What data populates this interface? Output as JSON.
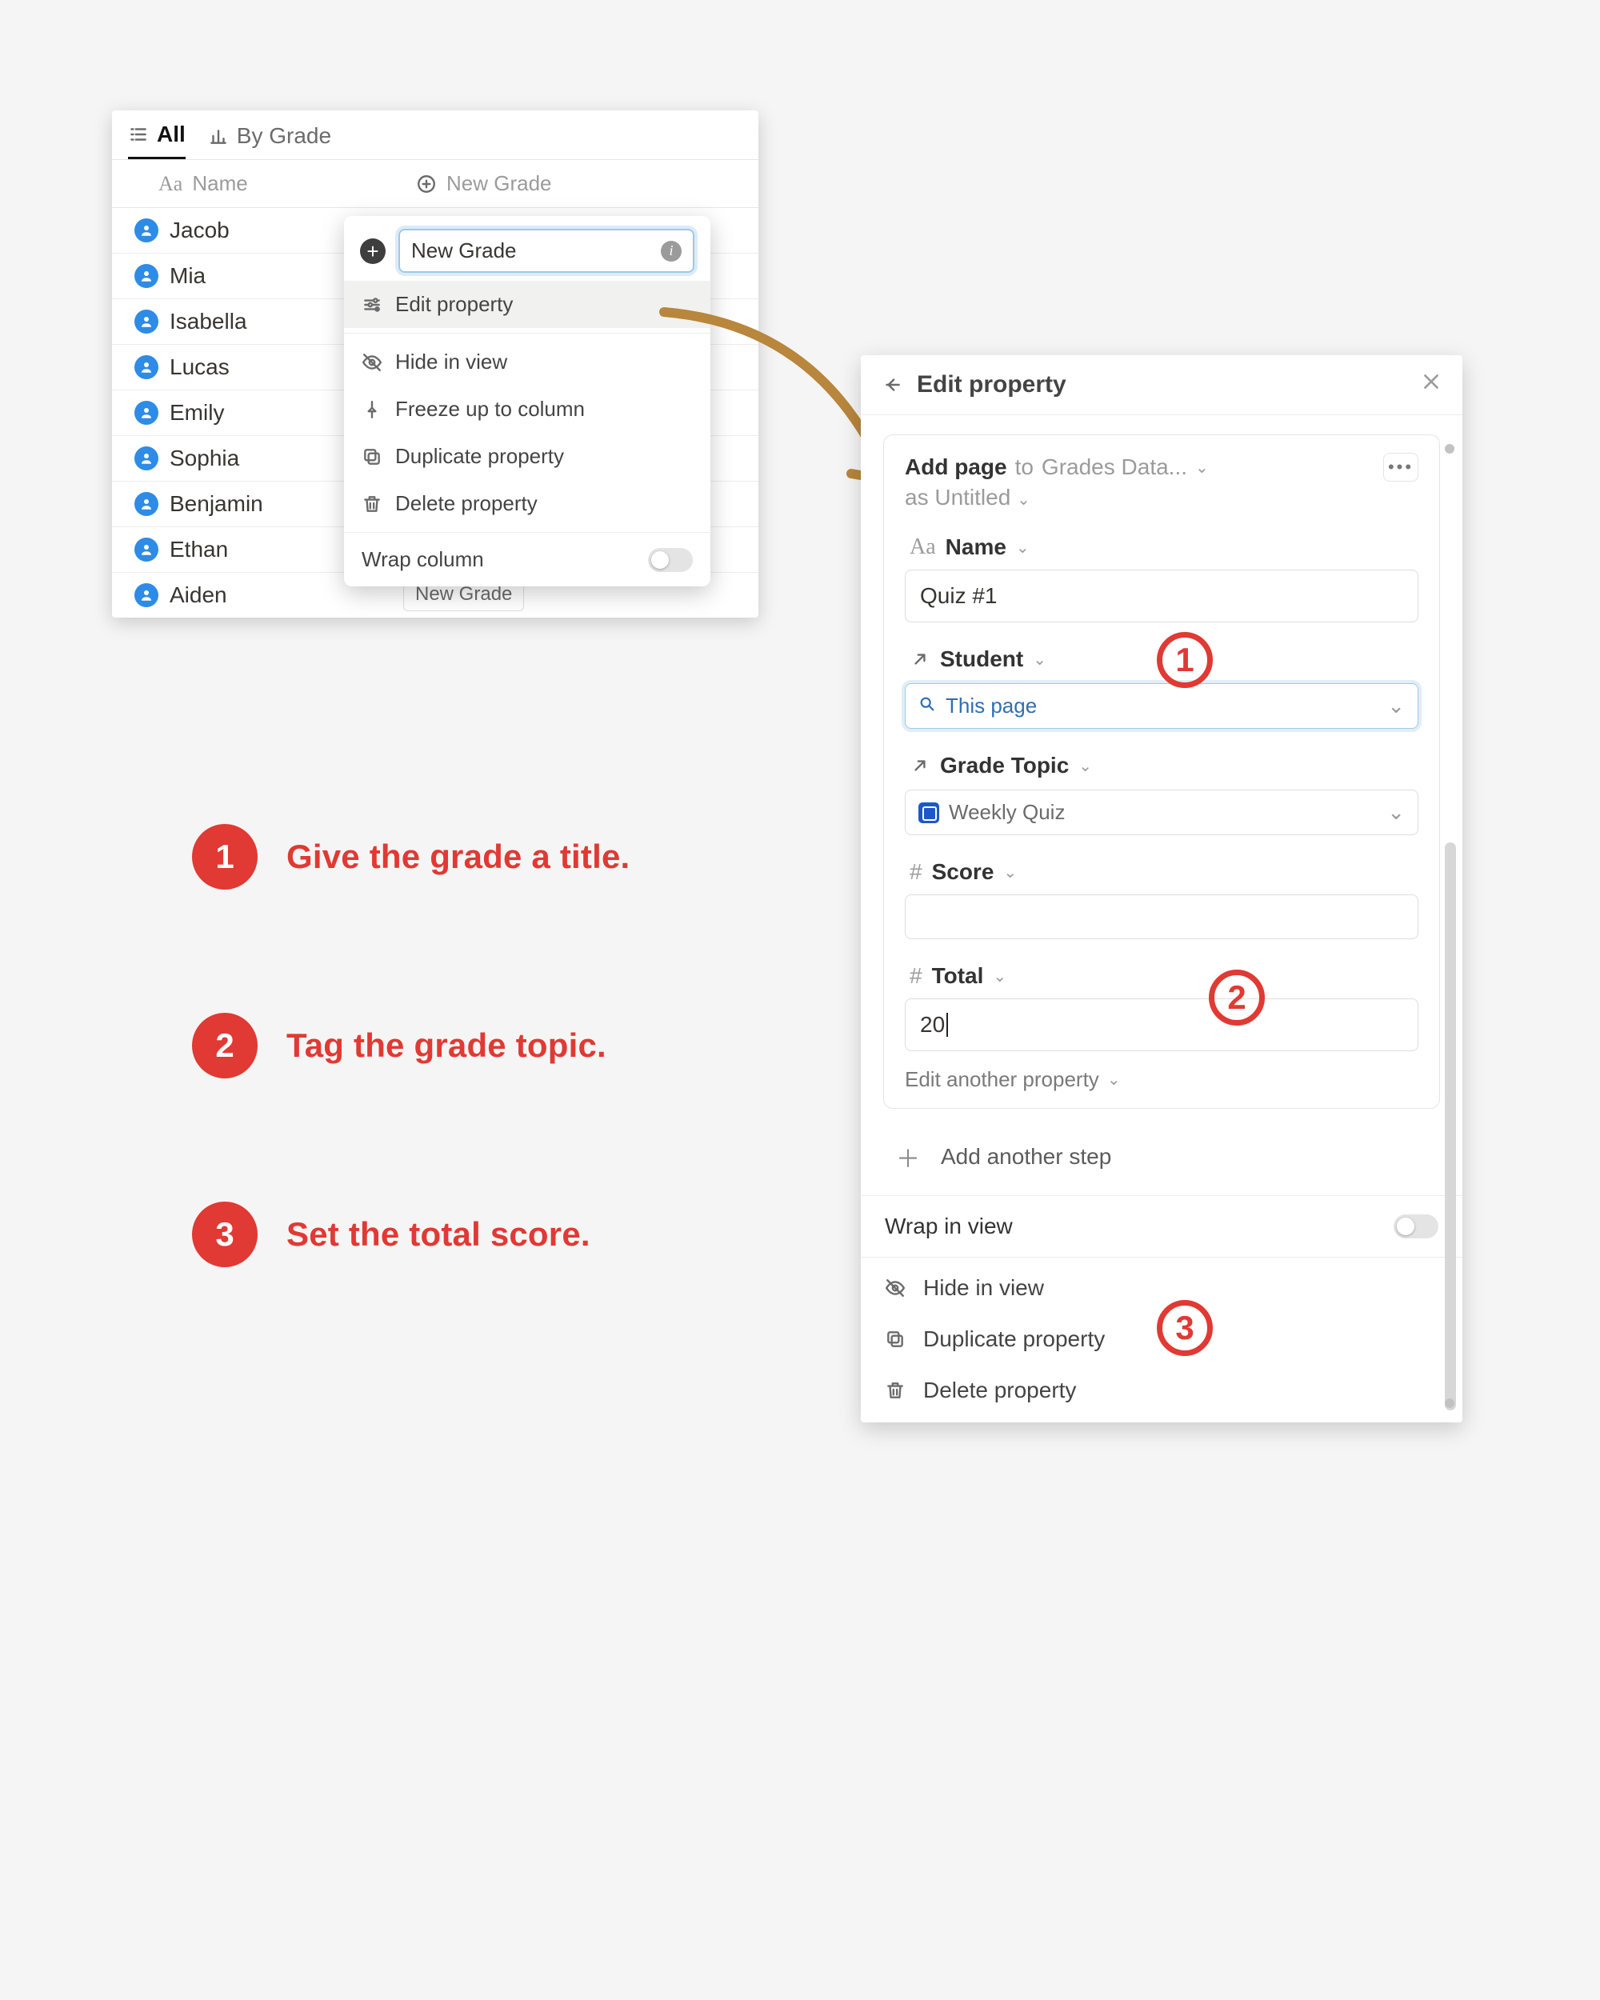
{
  "tabs": {
    "all": "All",
    "byGrade": "By Grade"
  },
  "columns": {
    "name": "Name",
    "newGrade": "New Grade"
  },
  "rows": [
    "Jacob",
    "Mia",
    "Isabella",
    "Lucas",
    "Emily",
    "Sophia",
    "Benjamin",
    "Ethan",
    "Aiden"
  ],
  "chip": "New Grade",
  "ctx": {
    "input": "New Grade",
    "edit": "Edit property",
    "hide": "Hide in view",
    "freeze": "Freeze up to column",
    "dup": "Duplicate property",
    "del": "Delete property",
    "wrap": "Wrap column"
  },
  "steps": {
    "s1": "Give the grade a title.",
    "s2": "Tag the grade topic.",
    "s3": "Set the total score."
  },
  "prop": {
    "title": "Edit property",
    "addPage": "Add page",
    "to": " to ",
    "db": "Grades Data...",
    "as": "as ",
    "untitled": "Untitled",
    "nameLabel": "Name",
    "nameValue": "Quiz #1",
    "studentLabel": "Student",
    "studentValue": "This page",
    "topicLabel": "Grade Topic",
    "topicValue": "Weekly Quiz",
    "scoreLabel": "Score",
    "totalLabel": "Total",
    "totalValue": "20",
    "editAnother": "Edit another property",
    "addStep": "Add another step",
    "wrap": "Wrap in view",
    "hide": "Hide in view",
    "dup": "Duplicate property",
    "del": "Delete property"
  }
}
